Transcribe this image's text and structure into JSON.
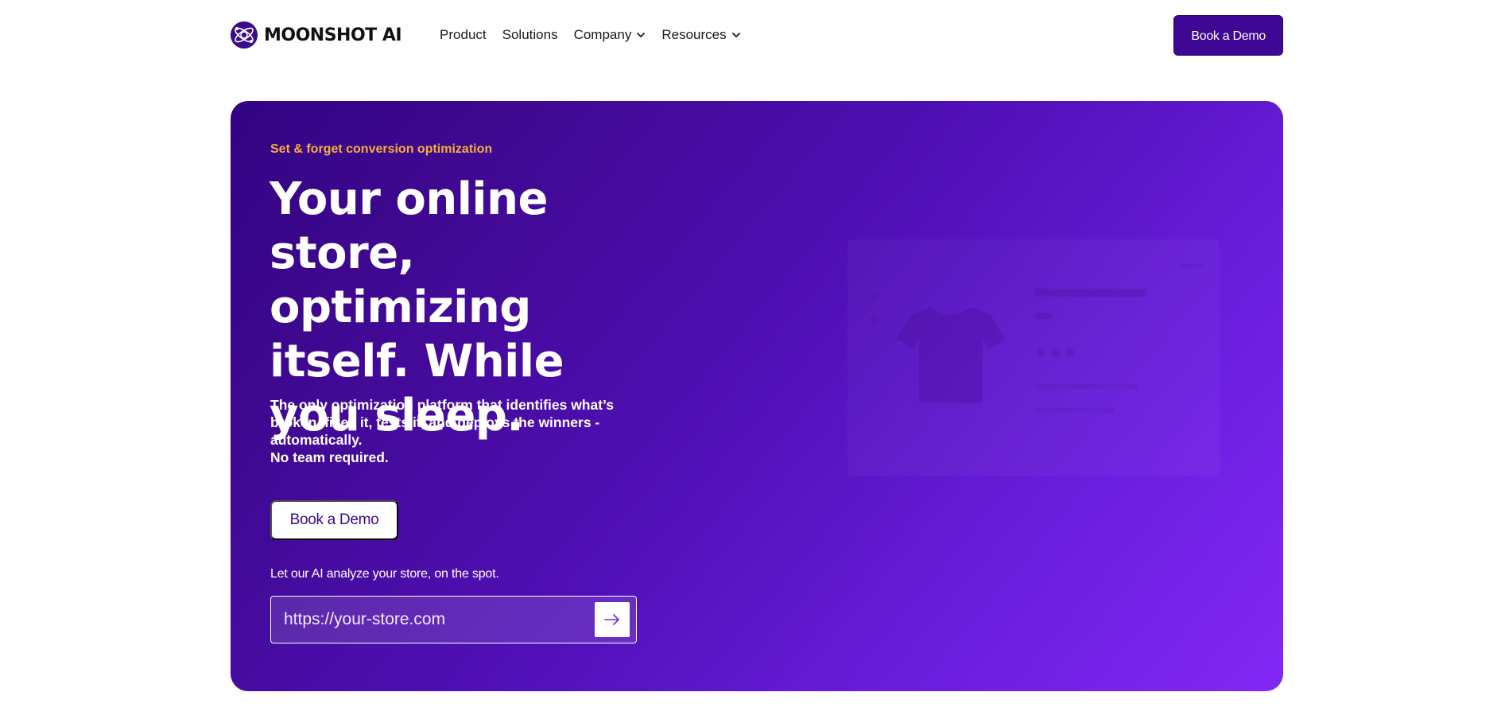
{
  "nav": {
    "brand": "MOONSHOT AI",
    "links": [
      {
        "label": "Product",
        "has_dropdown": false
      },
      {
        "label": "Solutions",
        "has_dropdown": false
      },
      {
        "label": "Company",
        "has_dropdown": true
      },
      {
        "label": "Resources",
        "has_dropdown": true
      }
    ],
    "cta_label": "Book a Demo"
  },
  "hero": {
    "eyebrow": "Set & forget conversion optimization",
    "headline": "Your online store, optimizing itself. While you sleep.",
    "subcopy_lines": [
      "The only optimization platform that identifies what’s broken, fixes it, tests it, and deploys the winners - automatically.",
      "No team required."
    ],
    "cta_label": "Book a Demo",
    "analyze_label": "Let our AI analyze your store, on the spot.",
    "url_input": {
      "value": "",
      "placeholder": "https://your-store.com"
    },
    "submit_icon": "arrow-right-icon"
  },
  "icons": {
    "logo": "moonshot-logo-icon",
    "dropdown": "chevron-down-icon",
    "mockup_product": "tshirt-icon"
  },
  "colors": {
    "brand": "#3e0794",
    "accent_eyebrow": "#f5b03b",
    "hero_gradient_start": "#320484",
    "hero_gradient_end": "#8327f5"
  }
}
